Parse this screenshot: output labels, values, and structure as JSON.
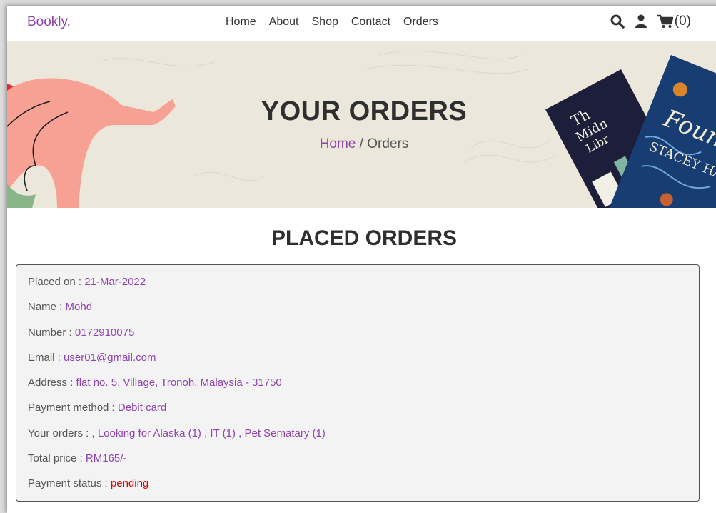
{
  "brand": {
    "logo": "Bookly."
  },
  "nav": {
    "items": [
      "Home",
      "About",
      "Shop",
      "Contact",
      "Orders"
    ]
  },
  "header_icons": {
    "search": "search-icon",
    "user": "user-icon",
    "cart": "cart-icon",
    "cart_count": "(0)"
  },
  "hero": {
    "title": "YOUR ORDERS",
    "breadcrumb_home": "Home",
    "breadcrumb_sep": " / ",
    "breadcrumb_current": "Orders"
  },
  "section": {
    "title": "PLACED ORDERS"
  },
  "order": {
    "fields": [
      {
        "label": "Placed on : ",
        "value": "21-Mar-2022"
      },
      {
        "label": "Name : ",
        "value": "Mohd"
      },
      {
        "label": "Number : ",
        "value": "0172910075"
      },
      {
        "label": "Email : ",
        "value": "user01@gmail.com"
      },
      {
        "label": "Address : ",
        "value": "flat no. 5, Village, Tronoh, Malaysia - 31750"
      },
      {
        "label": "Payment method : ",
        "value": "Debit card"
      },
      {
        "label": "Your orders : ",
        "value": ", Looking for Alaska (1) , IT (1) , Pet Sematary (1)"
      },
      {
        "label": "Total price : ",
        "value": "RM165/-"
      },
      {
        "label": "Payment status : ",
        "value": "pending"
      }
    ]
  },
  "colors": {
    "accent": "#8e44ad",
    "status_pending": "#e00000",
    "hero_bg": "#ebe7da"
  }
}
